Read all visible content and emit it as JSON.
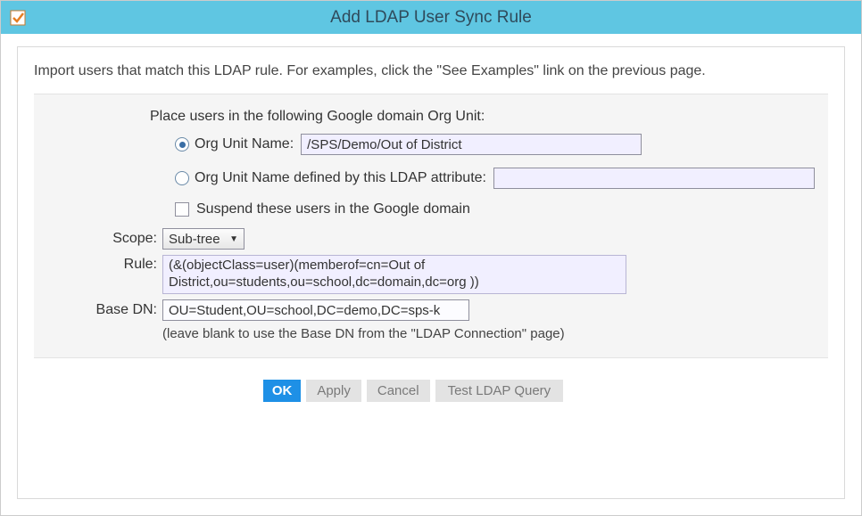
{
  "window": {
    "title": "Add LDAP User Sync Rule"
  },
  "intro": "Import users that match this LDAP rule.  For examples, click the \"See Examples\" link on the previous page.",
  "section_label": "Place users in the following Google domain Org Unit:",
  "radios": {
    "ou_name": {
      "label": "Org Unit Name:",
      "value": "/SPS/Demo/Out of District",
      "checked": true
    },
    "ldap_attr": {
      "label": "Org Unit Name defined by this LDAP attribute:",
      "value": "",
      "checked": false
    }
  },
  "suspend": {
    "label": "Suspend these users in the Google domain",
    "checked": false
  },
  "fields": {
    "scope": {
      "label": "Scope:",
      "value": "Sub-tree"
    },
    "rule": {
      "label": "Rule:",
      "value": "(&(objectClass=user)(memberof=cn=Out of District,ou=students,ou=school,dc=domain,dc=org ))"
    },
    "basedn": {
      "label": "Base DN:",
      "value": "OU=Student,OU=school,DC=demo,DC=sps-k",
      "hint": "(leave blank to use the Base DN from the \"LDAP Connection\" page)"
    }
  },
  "buttons": {
    "ok": "OK",
    "apply": "Apply",
    "cancel": "Cancel",
    "test": "Test LDAP Query"
  }
}
